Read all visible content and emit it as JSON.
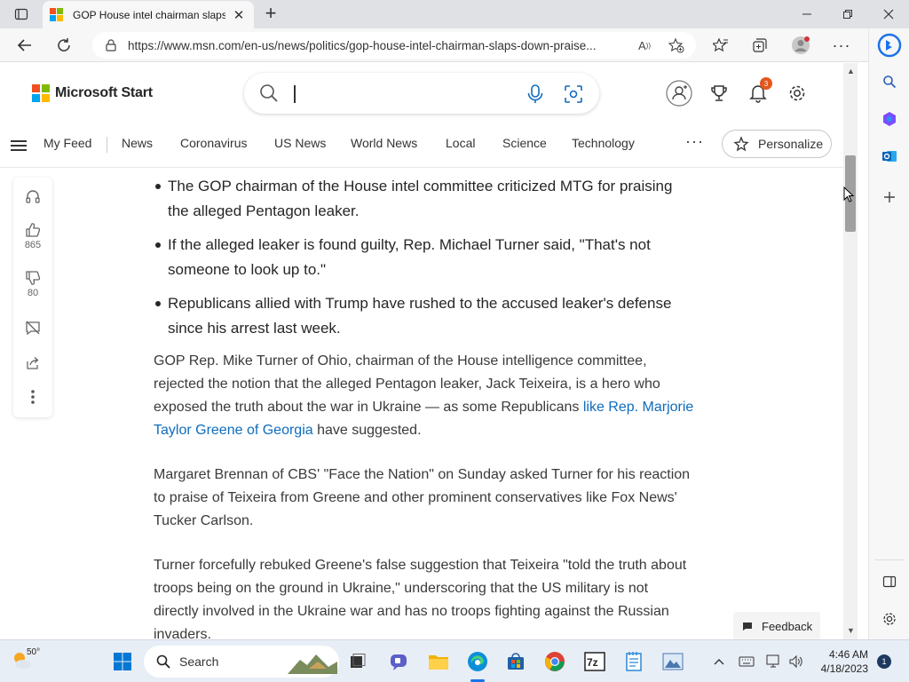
{
  "browser": {
    "tab_title": "GOP House intel chairman slaps",
    "url": "https://www.msn.com/en-us/news/politics/gop-house-intel-chairman-slaps-down-praise...",
    "read_aloud_icon": "read-aloud-icon"
  },
  "msn": {
    "logo_text": "Microsoft Start",
    "search_placeholder": "",
    "notifications_count": "3",
    "nav": [
      "My Feed",
      "News",
      "Coronavirus",
      "US News",
      "World News",
      "Local",
      "Science",
      "Technology"
    ],
    "more": "···",
    "personalize": "Personalize"
  },
  "rail": {
    "likes": "865",
    "dislikes": "80"
  },
  "article": {
    "bullets": [
      "The GOP chairman of the House intel committee criticized MTG for praising the alleged Pentagon leaker.",
      "If the alleged leaker is found guilty, Rep. Michael Turner said, \"That's not someone to look up to.\"",
      "Republicans allied with Trump have rushed to the accused leaker's defense since his arrest last week."
    ],
    "p1_before": "GOP Rep. Mike Turner of Ohio, chairman of the House intelligence committee, rejected the notion that the alleged Pentagon leaker, Jack Teixeira, is a hero who exposed the truth about the war in Ukraine — as some Republicans ",
    "p1_link": "like Rep. Marjorie Taylor Greene of Georgia",
    "p1_after": " have suggested.",
    "p2": "Margaret Brennan of CBS' \"Face the Nation\" on Sunday asked Turner for his reaction to praise of Teixeira from Greene and other prominent conservatives like Fox News' Tucker Carlson.",
    "p3": "Turner forcefully rebuked Greene's false suggestion that Teixeira \"told the truth about troops being on the ground in Ukraine,\" underscoring that the US military is not directly involved in the Ukraine war and has no troops fighting against the Russian invaders."
  },
  "feedback": "Feedback",
  "taskbar": {
    "weather_temp": "50°",
    "search_label": "Search",
    "time": "4:46 AM",
    "date": "4/18/2023",
    "notifications": "1"
  },
  "colors": {
    "accent": "#0f6cbd",
    "ms_red": "#f25022",
    "ms_green": "#7fba00",
    "ms_blue": "#00a4ef",
    "ms_yellow": "#ffb900"
  }
}
